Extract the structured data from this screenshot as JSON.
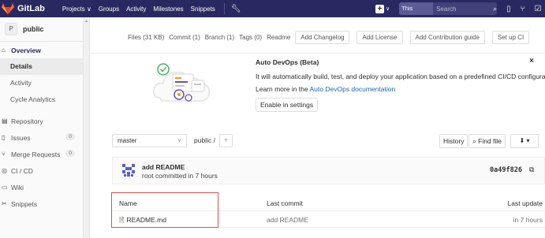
{
  "topnav": {
    "brand": "GitLab",
    "links": [
      "Projects ∨",
      "Groups",
      "Activity",
      "Milestones",
      "Snippets"
    ],
    "scope_label": "This project",
    "search_placeholder": "Search",
    "colors": {
      "background": "#292961",
      "logo": "#fc6d26"
    }
  },
  "sidebar": {
    "project_initial": "P",
    "project_name": "public",
    "overview": "Overview",
    "overview_sub": [
      "Details",
      "Activity",
      "Cycle Analytics"
    ],
    "items": [
      {
        "label": "Repository",
        "icon": "book-icon"
      },
      {
        "label": "Issues",
        "icon": "issues-icon",
        "badge": "0"
      },
      {
        "label": "Merge Requests",
        "icon": "merge-icon",
        "badge": "0"
      },
      {
        "label": "CI / CD",
        "icon": "rocket-icon"
      },
      {
        "label": "Wiki",
        "icon": "wiki-icon"
      },
      {
        "label": "Snippets",
        "icon": "scissors-icon"
      }
    ]
  },
  "stats": {
    "files": "Files (31 KB)",
    "commit": "Commit (1)",
    "branch": "Branch (1)",
    "tags": "Tags (0)",
    "readme": "Readme",
    "buttons": [
      "Add Changelog",
      "Add License",
      "Add Contribution guide",
      "Set up CI"
    ]
  },
  "devops": {
    "title": "Auto DevOps (Beta)",
    "text": "It will automatically build, test, and deploy your application based on a predefined CI/CD configuration.",
    "more_prefix": "Learn more in the ",
    "more_link": "Auto DevOps documentation",
    "enable_button": "Enable in settings"
  },
  "repo": {
    "branch": "master",
    "path": "public /",
    "history": "History",
    "find_file": "Find file",
    "download": "⬇ ▾"
  },
  "commit": {
    "title": "add README",
    "meta": "root committed in 7 hours",
    "sha": "0a49f826"
  },
  "files": {
    "headers": [
      "Name",
      "Last commit",
      "Last update"
    ],
    "rows": [
      {
        "name": "README.md",
        "last_commit": "add README",
        "last_update": "in 7 hours"
      }
    ]
  }
}
